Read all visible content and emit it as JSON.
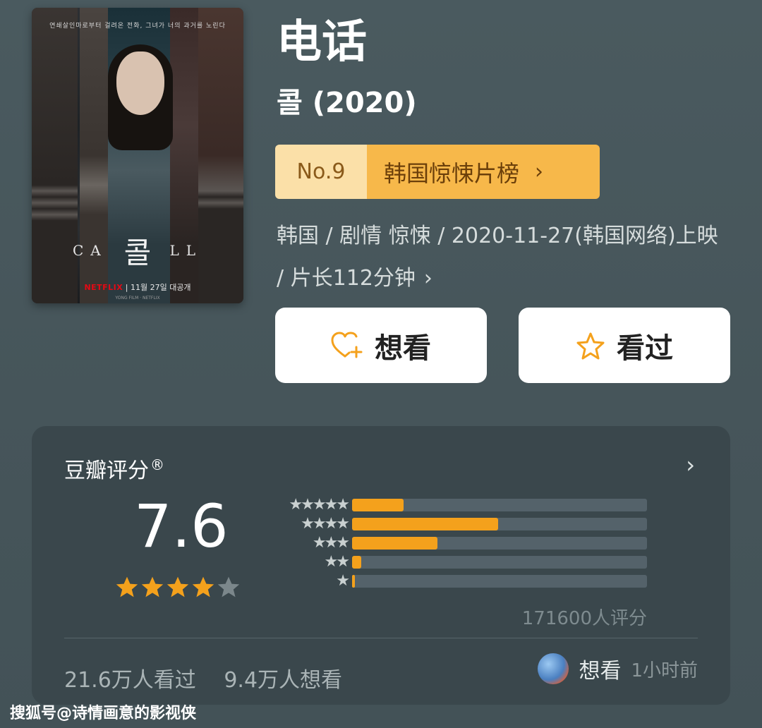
{
  "poster": {
    "tagline": "연쇄살인마로부터 걸려온 전화, 그녀가 너의 과거를 노린다",
    "title_left": "CA",
    "title_main": "콜",
    "title_right": "LL",
    "brand": "NETFLIX",
    "release": "11월 27일 대공개",
    "fine_print": "YONG FILM · NETFLIX"
  },
  "movie": {
    "title": "电话",
    "original_title": "콜 (2020)",
    "rank_no": "No.9",
    "rank_list": "韩国惊悚片榜",
    "meta_line": "韩国 / 剧情 惊悚 / 2020-11-27(韩国网络)上映 / 片长112分钟",
    "meta_chevron": "›"
  },
  "actions": {
    "want_label": "想看",
    "seen_label": "看过"
  },
  "rating": {
    "title": "豆瓣评分",
    "reg_mark": "®",
    "chevron": "›",
    "score": "7.6",
    "stars_filled": 4,
    "stars_total": 5,
    "distribution": [
      {
        "stars": "★★★★★",
        "percent": 17.5
      },
      {
        "stars": "★★★★",
        "percent": 49.5
      },
      {
        "stars": "★★★",
        "percent": 29
      },
      {
        "stars": "★★",
        "percent": 3
      },
      {
        "stars": "★",
        "percent": 1
      }
    ],
    "raters": "171600人评分",
    "seen_count": "21.6万人看过",
    "want_count": "9.4万人想看",
    "recent_action": "想看",
    "recent_time": "1小时前"
  },
  "colors": {
    "star": "#f4a11c",
    "star_empty": "#7b878b",
    "bar_fill": "#f4a11c",
    "bar_track": "#54626a"
  },
  "icons": {
    "want": "heart-plus-icon",
    "seen": "star-outline-icon"
  },
  "watermark": "搜狐号@诗情画意的影视侠"
}
